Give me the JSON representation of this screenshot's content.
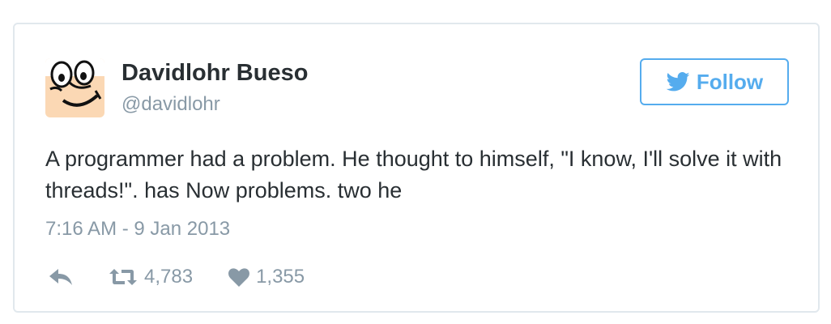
{
  "tweet": {
    "author": {
      "name": "Davidlohr Bueso",
      "handle": "@davidlohr",
      "avatar_icon": "cartoon-face-avatar"
    },
    "follow_button": {
      "label": "Follow",
      "icon": "twitter-bird-icon"
    },
    "text": "A programmer had a problem. He thought to himself, \"I know, I'll solve it with threads!\". has Now problems. two he",
    "timestamp": "7:16 AM - 9 Jan 2013",
    "actions": {
      "reply_icon": "reply-icon",
      "retweet_icon": "retweet-icon",
      "retweet_count": "4,783",
      "like_icon": "heart-icon",
      "like_count": "1,355"
    }
  },
  "colors": {
    "accent": "#55acee",
    "text": "#292f33",
    "muted": "#8899a6",
    "border": "#e1e8ed"
  }
}
